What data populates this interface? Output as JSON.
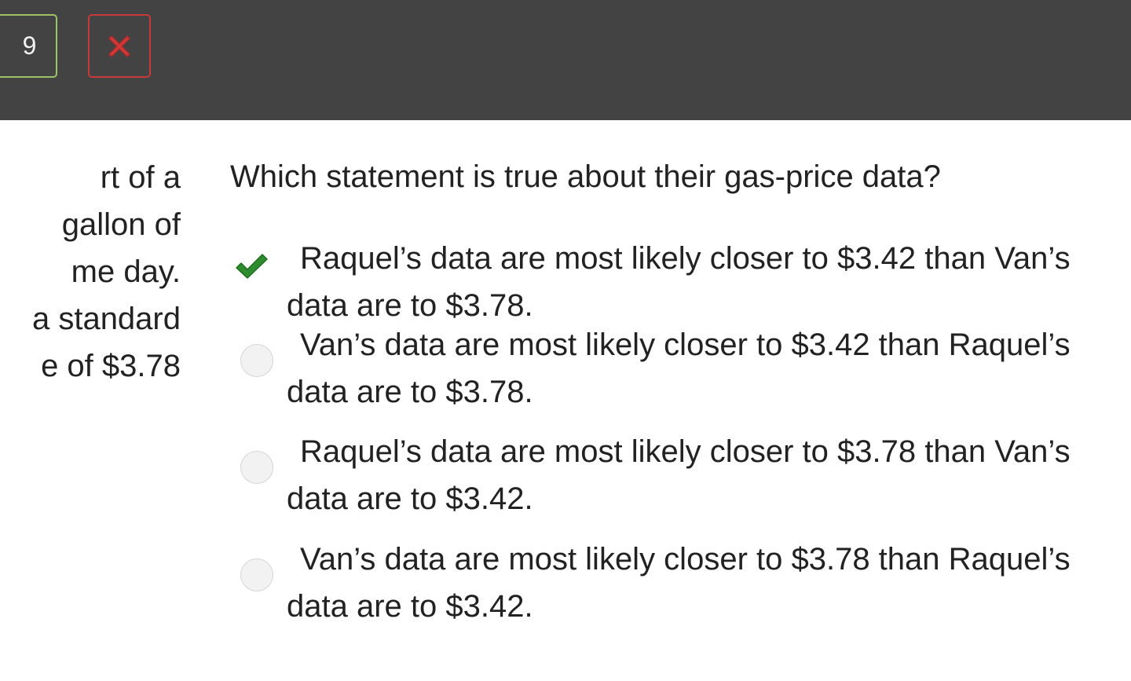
{
  "header": {
    "question_number": "9",
    "close_icon": "close-x-icon",
    "colors": {
      "bar": "#434343",
      "number_border": "#9dc26a",
      "close_border": "#c83a3a",
      "close_icon": "#d23a3a"
    }
  },
  "passage": {
    "lines": [
      "rt of a",
      "gallon of",
      "me day.",
      "a standard",
      "e of $3.78"
    ]
  },
  "question": {
    "prompt": "Which statement is true about their gas-price data?"
  },
  "options": [
    {
      "text": "Raquel’s data are most likely closer to $3.42 than Van’s data are to $3.78.",
      "state": "selected-correct",
      "icon": "check-icon",
      "color": "#2e8b2e"
    },
    {
      "text": "Van’s data are most likely closer to $3.42 than Raquel’s data are to $3.78.",
      "state": "unselected",
      "icon": "radio-icon"
    },
    {
      "text": "Raquel’s data are most likely closer to $3.78 than Van’s data are to $3.42.",
      "state": "unselected",
      "icon": "radio-icon"
    },
    {
      "text": "Van’s data are most likely closer to $3.78 than Raquel’s data are to $3.42.",
      "state": "unselected",
      "icon": "radio-icon"
    }
  ]
}
